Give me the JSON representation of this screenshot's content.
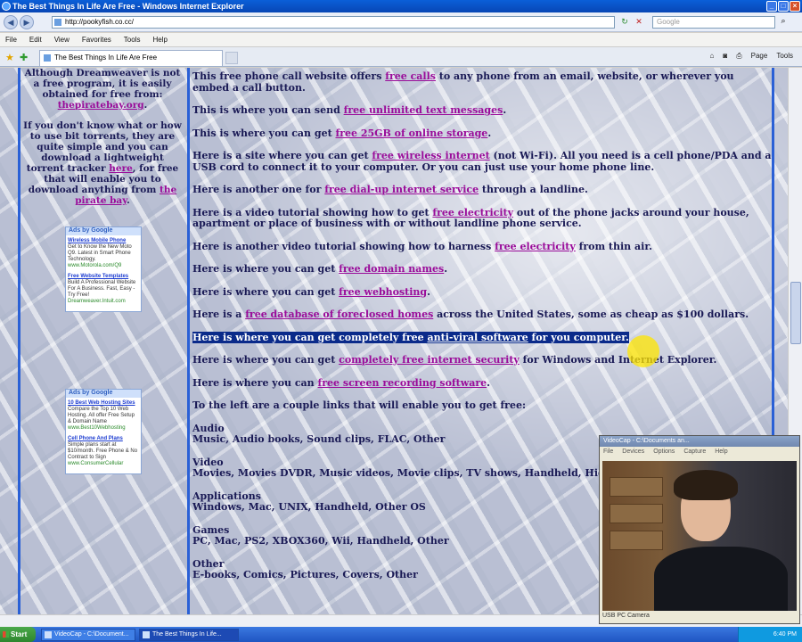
{
  "window": {
    "title": "The Best Things In Life Are Free - Windows Internet Explorer"
  },
  "address": {
    "url": "http://pookyfish.co.cc/",
    "search_placeholder": "Google"
  },
  "menu": [
    "File",
    "Edit",
    "View",
    "Favorites",
    "Tools",
    "Help"
  ],
  "tab": {
    "title": "The Best Things In Life Are Free"
  },
  "command_bar": {
    "page_label": "Page",
    "tools_label": "Tools"
  },
  "left_column": {
    "p1": "Although Dreamweaver is not a free program, it is easily obtained for free from:",
    "p1_link": "thepiratebay.org",
    "p1_end": ".",
    "p2": "If you don't know what or how to use bit torrents, they are quite simple and you can download a lightweight torrent tracker",
    "p2_link1": "here",
    "p2_mid": ", for free that will enable you to download anything from",
    "p2_link2": "the pirate bay",
    "p2_end": "."
  },
  "ads": [
    {
      "header": "Ads by Google",
      "items": [
        {
          "title": "Wireless Mobile Phone",
          "text": "Get to Know the New Moto Q9. Latest in Smart Phone Technology.",
          "url": "www.Motorola.com/Q9"
        },
        {
          "title": "Free Website Templates",
          "text": "Build A Professional Website For A Business. Fast, Easy - Try Free!",
          "url": "Dreamweaver.Intuit.com"
        }
      ]
    },
    {
      "header": "Ads by Google",
      "items": [
        {
          "title": "10 Best Web Hosting Sites",
          "text": "Compare the Top 10 Web Hosting. All offer Free Setup & Domain Name",
          "url": "www.Best10Webhosting"
        },
        {
          "title": "Cell Phone And Plans",
          "text": "Simple plans start at $10/month. Free Phone & No Contract to Sign",
          "url": "www.ConsumerCellular"
        }
      ]
    }
  ],
  "main": {
    "items": [
      {
        "before": "This free phone call website offers ",
        "link": "free calls",
        "after": " to any phone from an email, website, or wherever you embed a call button."
      },
      {
        "before": "This is where you can send ",
        "link": "free unlimited text messages",
        "after": "."
      },
      {
        "before": "This is where you can get ",
        "link": "free 25GB of online storage",
        "after": "."
      },
      {
        "before": "Here is a site where you can get ",
        "link": "free wireless internet",
        "after": " (not Wi-Fi). All you need is a cell phone/PDA and a USB cord to connect it to your computer. Or you can just use your home phone line."
      },
      {
        "before": "Here is another one for ",
        "link": "free dial-up internet service",
        "after": " through a landline."
      },
      {
        "before": "Here is a video tutorial showing how to get ",
        "link": "free electricity",
        "after": " out of the phone jacks around your house, apartment or place of business with or without landline phone service."
      },
      {
        "before": "Here is another video tutorial showing how to harness ",
        "link": "free electricity",
        "after": " from thin air."
      },
      {
        "before": "Here is where you can get ",
        "link": "free domain names",
        "after": "."
      },
      {
        "before": "Here is where you can get ",
        "link": "free webhosting",
        "after": "."
      },
      {
        "before": "Here is a ",
        "link": "free database of foreclosed homes",
        "after": " across the United States, some as cheap as $100 dollars."
      },
      {
        "before": "Here is where you can get completely free ",
        "link": "anti-viral software",
        "after": " for you computer."
      },
      {
        "before": "Here is where you can get ",
        "link": "completely free internet security",
        "after": " for Windows and Internet Explorer."
      },
      {
        "before": "Here is where you can ",
        "link": "free screen recording software",
        "after": "."
      }
    ],
    "intro": "To the left are a couple links that will enable you to get free:",
    "categories": [
      {
        "heading": "Audio",
        "list": "Music, Audio books, Sound clips, FLAC, Other"
      },
      {
        "heading": "Video",
        "list": "Movies, Movies DVDR, Music videos, Movie clips, TV shows, Handheld, High shows, Other"
      },
      {
        "heading": "Applications",
        "list": "Windows, Mac, UNIX, Handheld, Other OS"
      },
      {
        "heading": "Games",
        "list": "PC, Mac, PS2, XBOX360, Wii, Handheld, Other"
      },
      {
        "heading": "Other",
        "list": "E-books, Comics, Pictures, Covers, Other"
      }
    ]
  },
  "webcam": {
    "title": "VideoCap - C:\\Documents an...",
    "menu": [
      "File",
      "Devices",
      "Options",
      "Capture",
      "Help"
    ],
    "status": "USB PC Camera"
  },
  "taskbar": {
    "start_label": "Start",
    "tasks": [
      "VideoCap - C:\\Document...",
      "The Best Things In Life..."
    ],
    "clock": "6:40 PM"
  },
  "colors": {
    "link": "#9a0c9a",
    "text": "#1a1a55",
    "selection": "#0a2a8a",
    "side_rule": "#2a60d6"
  }
}
